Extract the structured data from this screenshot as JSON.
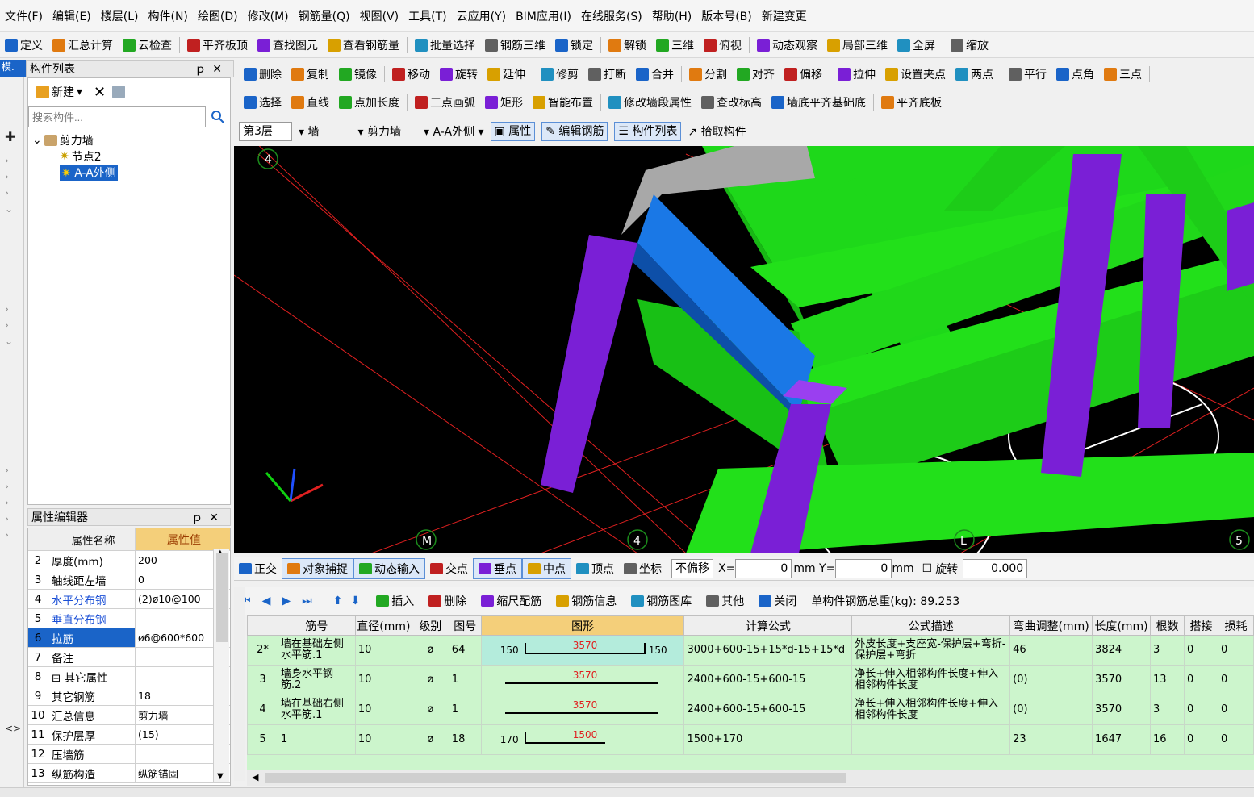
{
  "menu": [
    "文件(F)",
    "编辑(E)",
    "楼层(L)",
    "构件(N)",
    "绘图(D)",
    "修改(M)",
    "钢筋量(Q)",
    "视图(V)",
    "工具(T)",
    "云应用(Y)",
    "BIM应用(I)",
    "在线服务(S)",
    "帮助(H)",
    "版本号(B)",
    "新建变更"
  ],
  "toolbar1": [
    "定义",
    "汇总计算",
    "云检查",
    "平齐板顶",
    "查找图元",
    "查看钢筋量",
    "批量选择",
    "钢筋三维",
    "锁定",
    "解锁",
    "三维",
    "俯视",
    "动态观察",
    "局部三维",
    "全屏",
    "缩放"
  ],
  "toolbar2": [
    "删除",
    "复制",
    "镜像",
    "移动",
    "旋转",
    "延伸",
    "修剪",
    "打断",
    "合并",
    "分割",
    "对齐",
    "偏移",
    "拉伸",
    "设置夹点",
    "两点",
    "平行",
    "点角",
    "三点"
  ],
  "toolbar3": [
    "选择",
    "直线",
    "点加长度",
    "三点画弧",
    "矩形",
    "智能布置",
    "修改墙段属性",
    "查改标高",
    "墙底平齐基础底",
    "平齐底板"
  ],
  "toolbar4": {
    "floor": "第3层",
    "type": "墙",
    "subtype": "剪力墙",
    "element": "A-A外侧",
    "buttons": [
      "属性",
      "编辑钢筋",
      "构件列表",
      "拾取构件"
    ]
  },
  "component_panel": {
    "title": "构件列表",
    "new_label": "新建",
    "search_placeholder": "搜索构件...",
    "tree_root": "剪力墙",
    "tree_children": [
      "节点2",
      "A-A外侧"
    ]
  },
  "prop_panel": {
    "title": "属性编辑器",
    "col_name": "属性名称",
    "col_value": "属性值",
    "rows": [
      {
        "n": "2",
        "k": "厚度(mm)",
        "v": "200",
        "blue": false
      },
      {
        "n": "3",
        "k": "轴线距左墙",
        "v": "0",
        "blue": false
      },
      {
        "n": "4",
        "k": "水平分布钢",
        "v": "(2)ø10@100",
        "blue": true
      },
      {
        "n": "5",
        "k": "垂直分布钢",
        "v": "",
        "blue": true
      },
      {
        "n": "6",
        "k": "拉筋",
        "v": "ø6@600*600",
        "blue": true
      },
      {
        "n": "7",
        "k": "备注",
        "v": "",
        "blue": false
      },
      {
        "n": "8",
        "k": "⊟ 其它属性",
        "v": "",
        "blue": false
      },
      {
        "n": "9",
        "k": "   其它钢筋",
        "v": "18",
        "blue": false
      },
      {
        "n": "10",
        "k": "   汇总信息",
        "v": "剪力墙",
        "blue": false
      },
      {
        "n": "11",
        "k": "   保护层厚",
        "v": "(15)",
        "blue": false
      },
      {
        "n": "12",
        "k": "   压墙筋",
        "v": "",
        "blue": false
      },
      {
        "n": "13",
        "k": "   纵筋构造",
        "v": "纵筋锚固",
        "blue": false
      }
    ]
  },
  "viewport": {
    "axis_labels": [
      "4",
      "M",
      "4",
      "L",
      "5"
    ],
    "colors": {
      "column": "#7a1fd6",
      "beam": "#22e01a",
      "wall": "#1a78e6",
      "top": "#a8a8a8"
    }
  },
  "snap_toolbar": {
    "buttons": [
      "正交",
      "对象捕捉",
      "动态输入",
      "交点",
      "垂点",
      "中点",
      "顶点",
      "坐标"
    ],
    "offset_mode": "不偏移",
    "x_label": "X=",
    "x_value": "0",
    "y_label": "mm Y=",
    "y_value": "0",
    "y_unit": "mm",
    "rotate_label": "旋转",
    "rotate_value": "0.000"
  },
  "rebar_toolbar": {
    "buttons": [
      "插入",
      "删除",
      "缩尺配筋",
      "钢筋信息",
      "钢筋图库",
      "其他",
      "关闭"
    ],
    "total_label": "单构件钢筋总重(kg): 89.253"
  },
  "rebar_table": {
    "headers": [
      "",
      "筋号",
      "直径(mm)",
      "级别",
      "图号",
      "图形",
      "计算公式",
      "公式描述",
      "弯曲调整(mm)",
      "长度(mm)",
      "根数",
      "搭接",
      "损耗"
    ],
    "rows": [
      {
        "idx": "2*",
        "name": "墙在基础左侧水平筋.1",
        "dia": "10",
        "grade": "ø",
        "fig": "64",
        "left": "150",
        "mid": "3570",
        "right": "150",
        "formula": "3000+600-15+15*d-15+15*d",
        "desc": "外皮长度+支座宽-保护层+弯折-保护层+弯折",
        "bend": "46",
        "len": "3824",
        "count": "3",
        "lap": "0",
        "loss": "0"
      },
      {
        "idx": "3",
        "name": "墙身水平钢筋.2",
        "dia": "10",
        "grade": "ø",
        "fig": "1",
        "left": "",
        "mid": "3570",
        "right": "",
        "formula": "2400+600-15+600-15",
        "desc": "净长+伸入相邻构件长度+伸入相邻构件长度",
        "bend": "(0)",
        "len": "3570",
        "count": "13",
        "lap": "0",
        "loss": "0"
      },
      {
        "idx": "4",
        "name": "墙在基础右侧水平筋.1",
        "dia": "10",
        "grade": "ø",
        "fig": "1",
        "left": "",
        "mid": "3570",
        "right": "",
        "formula": "2400+600-15+600-15",
        "desc": "净长+伸入相邻构件长度+伸入相邻构件长度",
        "bend": "(0)",
        "len": "3570",
        "count": "3",
        "lap": "0",
        "loss": "0"
      },
      {
        "idx": "5",
        "name": "1",
        "dia": "10",
        "grade": "ø",
        "fig": "18",
        "left": "170",
        "mid": "1500",
        "right": "",
        "formula": "1500+170",
        "desc": "",
        "bend": "23",
        "len": "1647",
        "count": "16",
        "lap": "0",
        "loss": "0"
      }
    ]
  }
}
